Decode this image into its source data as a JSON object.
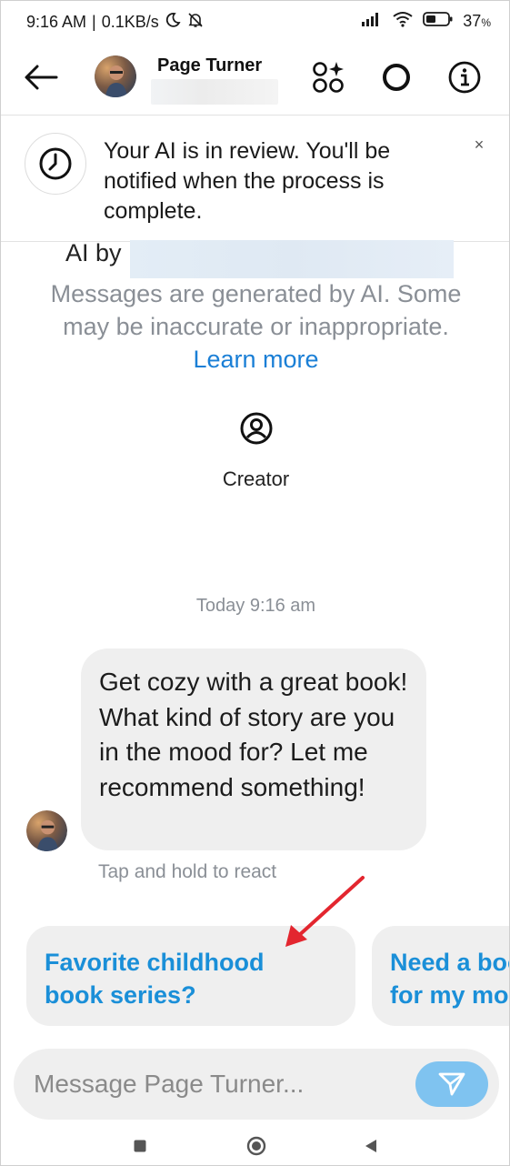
{
  "status_bar": {
    "time": "9:16 AM",
    "network_speed": "0.1KB/s",
    "battery": "37",
    "icons": [
      "moon-icon",
      "muted-icon",
      "signal-icon",
      "wifi-icon",
      "battery-icon"
    ]
  },
  "header": {
    "title": "Page Turner",
    "icons": [
      "back-arrow-icon",
      "ai-studio-icon",
      "theme-icon",
      "info-icon"
    ]
  },
  "banner": {
    "text": "Your AI is in review. You'll be notified when the process is complete.",
    "close_label": "×"
  },
  "ai_info": {
    "by_label": "AI by",
    "disclaimer": "Messages are generated by AI. Some may be inaccurate or inappropriate.",
    "learn_more": "Learn more",
    "creator_label": "Creator"
  },
  "chat": {
    "timestamp": "Today 9:16 am",
    "message": "Get cozy with a great book! What kind of story are you in the mood for? Let me recommend something!",
    "react_hint": "Tap and hold to react"
  },
  "suggestions": [
    {
      "text": "Favorite childhood book series?"
    },
    {
      "text": "Need a book for my mood"
    }
  ],
  "composer": {
    "placeholder": "Message Page Turner..."
  },
  "colors": {
    "link_blue": "#1a7fd6",
    "suggestion_blue": "#1a8fd8",
    "send_button": "#7fc3f0",
    "annotation_arrow": "#e3262f"
  }
}
